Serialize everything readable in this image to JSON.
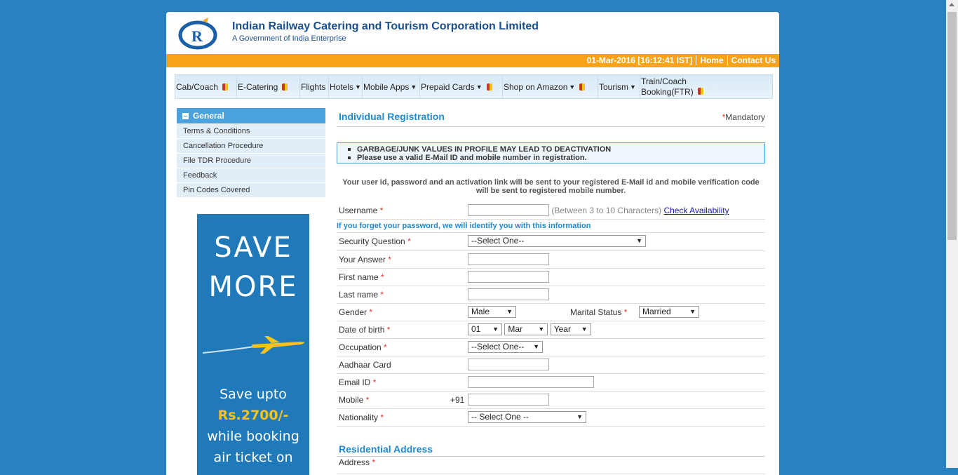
{
  "header": {
    "title": "Indian Railway Catering and Tourism Corporation Limited",
    "subtitle": "A Government of India Enterprise",
    "datetime": "01-Mar-2016 [16:12:41 IST]",
    "home": "Home",
    "contact": "Contact Us"
  },
  "nav": [
    "Cab/Coach",
    "E-Catering",
    "Flights",
    "Hotels",
    "Mobile Apps",
    "Prepaid Cards",
    "Shop on Amazon",
    "Tourism",
    "Train/Coach Booking(FTR)"
  ],
  "sidebar": {
    "heading": "General",
    "items": [
      "Terms & Conditions",
      "Cancellation Procedure",
      "File TDR Procedure",
      "Feedback",
      "Pin Codes Covered"
    ]
  },
  "ad": {
    "line1": "SAVE",
    "line2": "MORE",
    "line3": "Save upto",
    "line4": "Rs.2700/-",
    "line5": "while booking",
    "line6": "air ticket on"
  },
  "form": {
    "title": "Individual Registration",
    "mandatory": "Mandatory",
    "notice1": "GARBAGE/JUNK VALUES IN PROFILE MAY LEAD TO DEACTIVATION",
    "notice2": "Please use a valid E-Mail ID and mobile number in registration.",
    "info": "Your user id, password and an activation link will be sent to your registered E-Mail id and mobile verification code will be sent to registered mobile number.",
    "username": "Username",
    "username_hint": "(Between 3 to 10 Characters)",
    "check": "Check Availability",
    "forget": "If you forget your password, we will identify you with this information",
    "security_q": "Security Question",
    "security_val": "--Select One--",
    "answer": "Your Answer",
    "first": "First name",
    "last": "Last name",
    "gender": "Gender",
    "gender_val": "Male",
    "marital": "Marital Status",
    "marital_val": "Married",
    "dob": "Date of birth",
    "dob_day": "01",
    "dob_month": "Mar",
    "dob_year": "Year",
    "occupation": "Occupation",
    "occupation_val": "--Select One--",
    "aadhaar": "Aadhaar Card",
    "email": "Email ID",
    "mobile": "Mobile",
    "mobile_prefix": "+91",
    "nationality": "Nationality",
    "nationality_val": "-- Select One --",
    "residential": "Residential Address",
    "address": "Address"
  }
}
